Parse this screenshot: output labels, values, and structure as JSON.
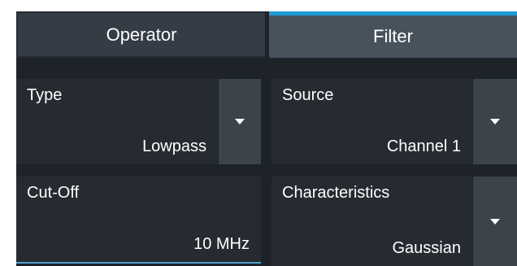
{
  "tabs": [
    {
      "label": "Operator",
      "active": false
    },
    {
      "label": "Filter",
      "active": true
    }
  ],
  "fields": {
    "type": {
      "label": "Type",
      "value": "Lowpass"
    },
    "source": {
      "label": "Source",
      "value": "Channel 1"
    },
    "cutoff": {
      "label": "Cut-Off",
      "value": "10 MHz"
    },
    "characteristics": {
      "label": "Characteristics",
      "value": "Gaussian"
    }
  },
  "colors": {
    "background": "#1d2329",
    "field_bg": "#252b31",
    "dropdown_button": "#3b434b",
    "active_tab": "#47525d",
    "accent": "#1e9bd7"
  },
  "icons": {
    "dropdown": "caret-down-icon"
  }
}
